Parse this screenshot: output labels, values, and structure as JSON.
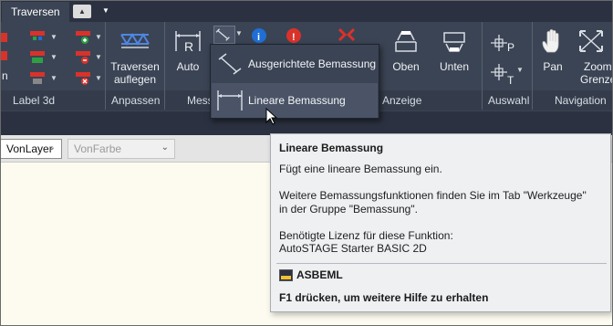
{
  "tabs": {
    "active_label": "Traversen"
  },
  "ribbon": {
    "groups": {
      "label3d": "Label 3d",
      "anpassen": "Anpassen",
      "mess": "Mess",
      "anzeige": "Anzeige",
      "auswahl": "Auswahl",
      "navigation": "Navigation"
    },
    "buttons": {
      "traversen_auflegen_1": "Traversen",
      "traversen_auflegen_2": "auflegen",
      "auto": "Auto",
      "oben": "Oben",
      "unten": "Unten",
      "pan": "Pan",
      "zoom_1": "Zoom",
      "zoom_2": "Grenze",
      "left_cut": "n"
    },
    "icon_letters": {
      "auto_r": "R",
      "auswahl_p": "P",
      "auswahl_t": "T"
    }
  },
  "dropdown": {
    "items": [
      {
        "label": "Ausgerichtete Bemassung"
      },
      {
        "label": "Lineare Bemassung"
      }
    ]
  },
  "propbar": {
    "layer_value": "VonLayer",
    "color_value": "VonFarbe"
  },
  "tooltip": {
    "title": "Lineare Bemassung",
    "line1": "Fügt eine lineare Bemassung ein.",
    "line2": "Weitere Bemassungsfunktionen finden Sie im Tab \"Werkzeuge\"",
    "line3": "in der Gruppe \"Bemassung\".",
    "line4": "Benötigte Lizenz für diese Funktion:",
    "line5": "AutoSTAGE Starter BASIC 2D",
    "command": "ASBEML",
    "help": "F1 drücken, um weitere Hilfe zu erhalten"
  },
  "colors": {
    "ribbon_bg": "#3b4454",
    "tab_bg": "#2b3140",
    "accent_red": "#d9322b",
    "accent_green": "#2ea043",
    "info_blue": "#1f6fd6",
    "tooltip_bg": "#eef0f2"
  }
}
